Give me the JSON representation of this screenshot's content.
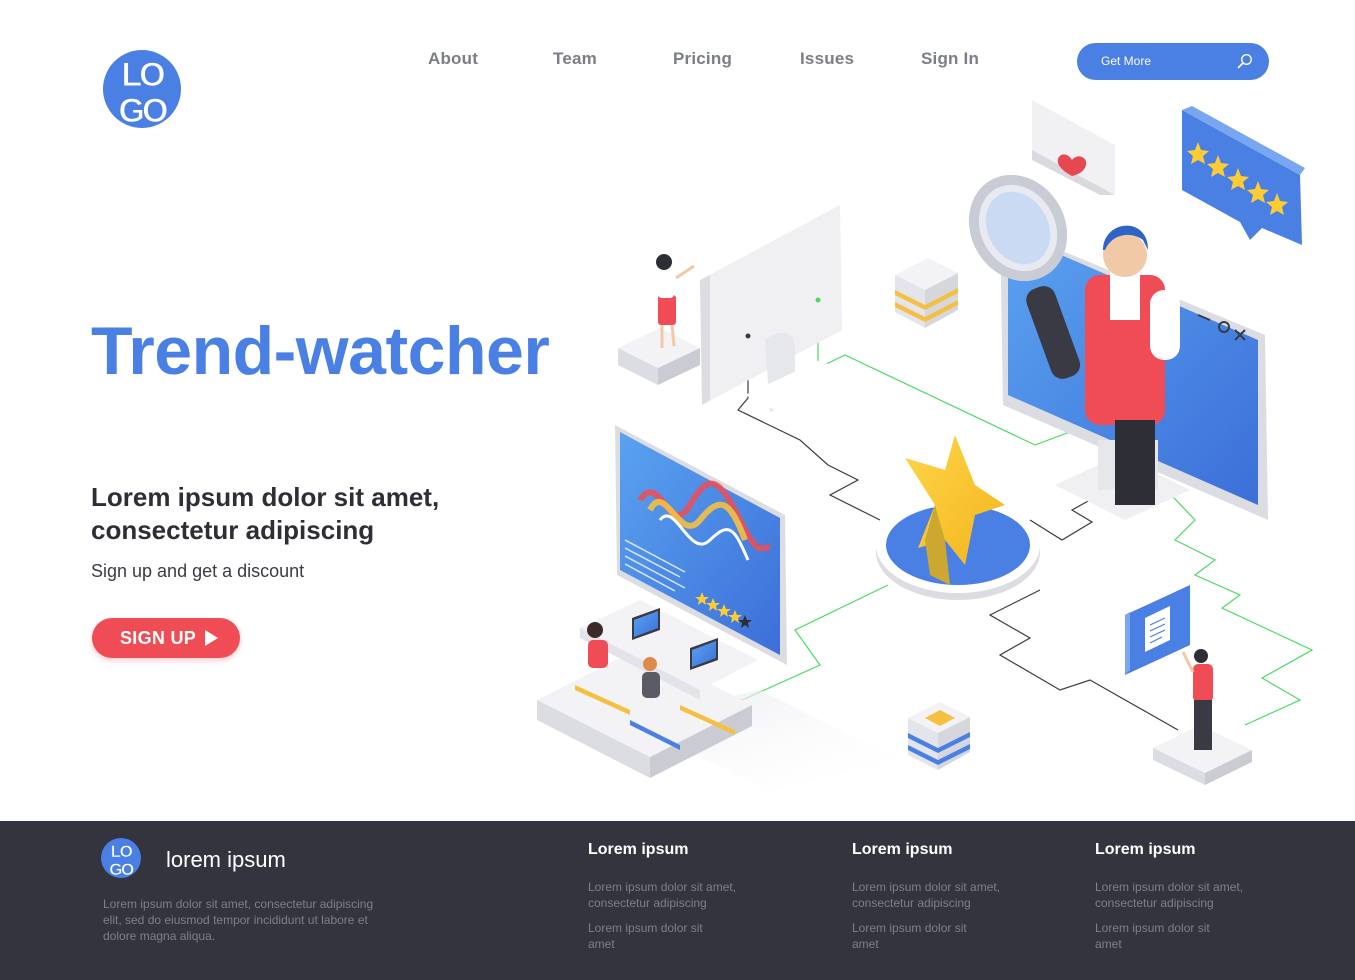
{
  "brand": {
    "logo_text_top": "LO",
    "logo_text_bottom": "GO",
    "accent_color": "#4a7fe3",
    "cta_color": "#f04c55",
    "footer_bg": "#33343e"
  },
  "nav": {
    "items": [
      {
        "label": "About"
      },
      {
        "label": "Team"
      },
      {
        "label": "Pricing"
      },
      {
        "label": "Issues"
      },
      {
        "label": "Sign In"
      }
    ],
    "search": {
      "label": "Get More",
      "icon": "search-icon"
    }
  },
  "hero": {
    "title": "Trend-watcher",
    "subtitle_line1": "Lorem ipsum dolor sit amet,",
    "subtitle_line2": "consectetur adipiscing",
    "tagline": "Sign up and get a discount",
    "cta_label": "SIGN UP",
    "cta_icon": "play-arrow-icon"
  },
  "illustration": {
    "rating_stars": 5,
    "chart_rating_stars": 4,
    "window_controls": [
      "minimize",
      "restore",
      "close"
    ],
    "icons": [
      "heart-icon",
      "star-icon",
      "magnifier-icon",
      "document-icon",
      "monitor-icon",
      "laptop-icon"
    ]
  },
  "footer": {
    "brand_name": "lorem ipsum",
    "description": "Lorem ipsum dolor sit amet, consectetur adipiscing elit, sed do eiusmod tempor incididunt ut labore et dolore magna aliqua.",
    "columns": [
      {
        "title": "Lorem ipsum",
        "links": [
          "Lorem ipsum dolor sit amet, consectetur adipiscing",
          "Lorem ipsum dolor sit amet"
        ]
      },
      {
        "title": "Lorem ipsum",
        "links": [
          "Lorem ipsum dolor sit amet, consectetur adipiscing",
          "Lorem ipsum dolor sit amet"
        ]
      },
      {
        "title": "Lorem ipsum",
        "links": [
          "Lorem ipsum dolor sit amet, consectetur adipiscing",
          "Lorem ipsum dolor sit amet"
        ]
      }
    ]
  }
}
